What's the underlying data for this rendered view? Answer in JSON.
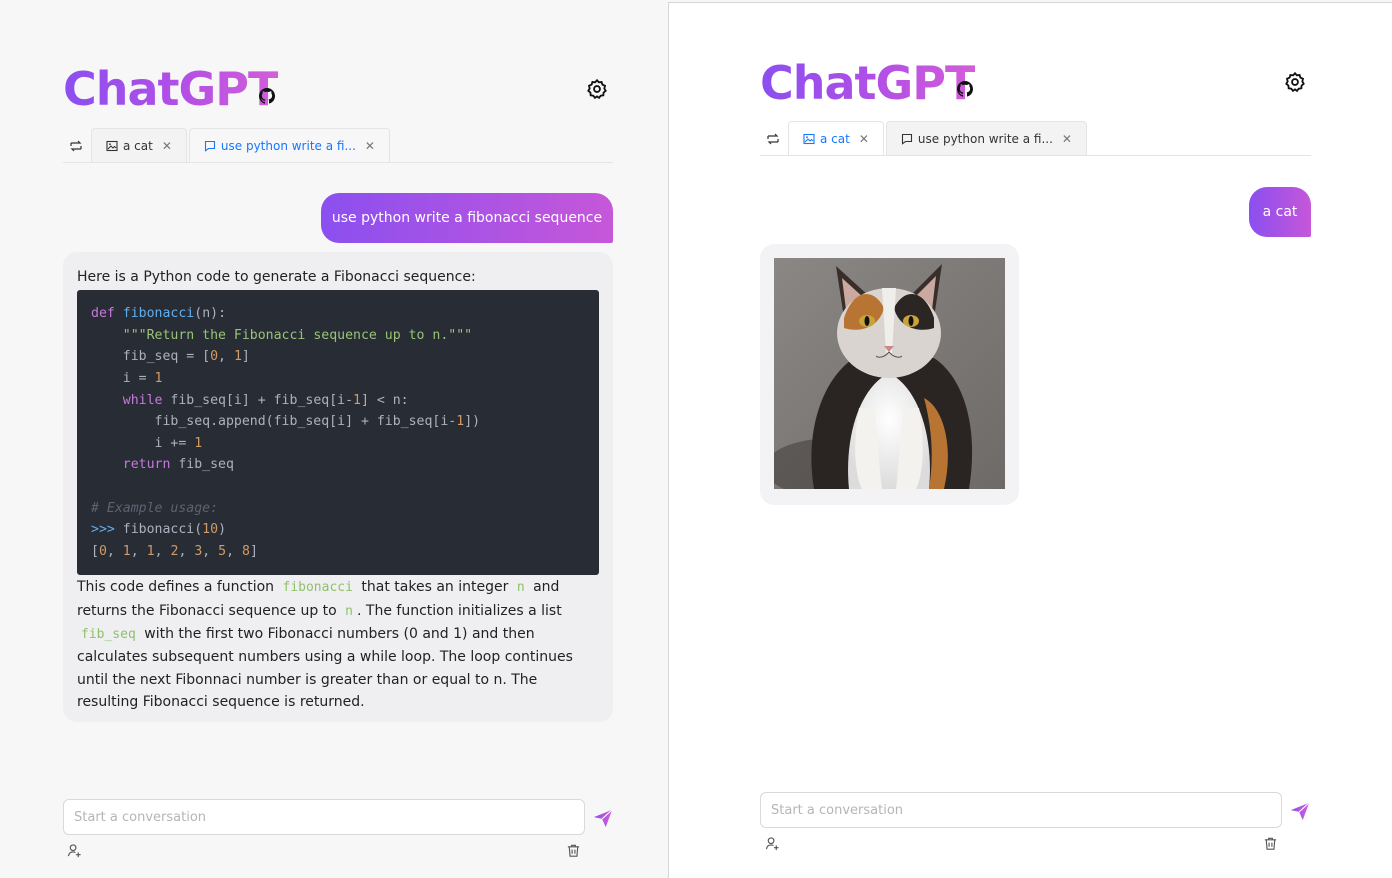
{
  "app": {
    "title": "ChatGPT"
  },
  "left": {
    "tabs": [
      {
        "label": "a cat",
        "icon": "image-icon",
        "active": false
      },
      {
        "label": "use python write a fi...",
        "icon": "message-icon",
        "active": true
      }
    ],
    "user_message": "use python write a fibonacci sequence",
    "bot": {
      "intro": "Here is a Python code to generate a Fibonacci sequence:",
      "code": {
        "language": "python",
        "lines": [
          "def fibonacci(n):",
          "    \"\"\"Return the Fibonacci sequence up to n.\"\"\"",
          "    fib_seq = [0, 1]",
          "    i = 1",
          "    while fib_seq[i] + fib_seq[i-1] < n:",
          "        fib_seq.append(fib_seq[i] + fib_seq[i-1])",
          "        i += 1",
          "    return fib_seq",
          "",
          "# Example usage:",
          ">>> fibonacci(10)",
          "[0, 1, 1, 2, 3, 5, 8]"
        ]
      },
      "explanation": {
        "p1": "This code defines a function",
        "c1": "fibonacci",
        "p2": "that takes an integer",
        "c2": "n",
        "p3": "and returns the Fibonacci sequence up to",
        "c3": "n",
        "p4": ". The function initializes a list",
        "c4": "fib_seq",
        "p5": "with the first two Fibonacci numbers (0 and 1) and then calculates subsequent numbers using a while loop. The loop continues until the next Fibonnaci number is greater than or equal to n. The resulting Fibonacci sequence is returned."
      }
    },
    "input": {
      "placeholder": "Start a conversation"
    }
  },
  "right": {
    "tabs": [
      {
        "label": "a cat",
        "icon": "image-icon",
        "active": true
      },
      {
        "label": "use python write a fi...",
        "icon": "message-icon",
        "active": false
      }
    ],
    "user_message": "a cat",
    "bot": {
      "image": "cat-photo"
    },
    "input": {
      "placeholder": "Start a conversation"
    }
  },
  "icons": {
    "github": "github-icon",
    "settings": "gear-icon",
    "new_tab": "new-chat-icon",
    "close": "close-icon",
    "send": "send-icon",
    "user": "add-user-icon",
    "delete": "trash-icon"
  },
  "colors": {
    "accent": "#9b51e0",
    "tab_active": "#1677ff",
    "code_bg": "#282c34"
  }
}
